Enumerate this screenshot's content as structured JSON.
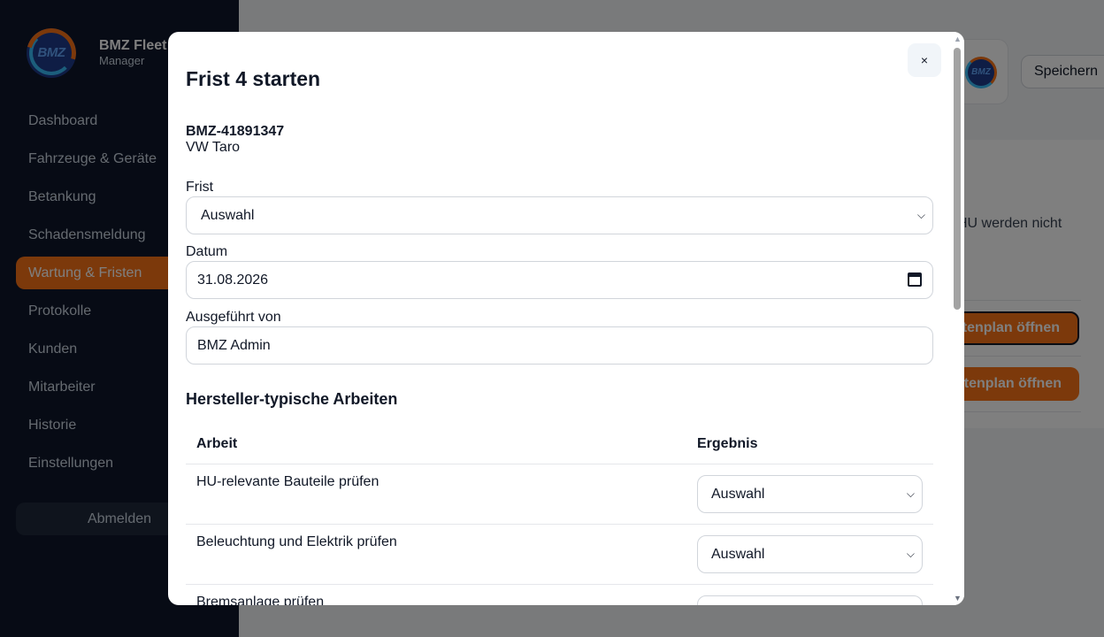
{
  "sidebar": {
    "brand_name": "BMZ Fleet",
    "brand_sub": "Manager",
    "logo_text": "BMZ",
    "items": [
      {
        "label": "Dashboard"
      },
      {
        "label": "Fahrzeuge & Geräte"
      },
      {
        "label": "Betankung"
      },
      {
        "label": "Schadensmeldung"
      },
      {
        "label": "Wartung & Fristen",
        "active": true
      },
      {
        "label": "Protokolle"
      },
      {
        "label": "Kunden"
      },
      {
        "label": "Mitarbeiter"
      },
      {
        "label": "Historie"
      },
      {
        "label": "Einstellungen"
      }
    ],
    "logout_label": "Abmelden"
  },
  "header": {
    "logo_text": "BMZ",
    "save_label": "Speichern"
  },
  "background_card": {
    "note": "HU werden nicht",
    "buttons": [
      "Fristenplan öffnen",
      "Fristenplan öffnen"
    ]
  },
  "modal": {
    "title": "Frist 4 starten",
    "close_label": "×",
    "vehicle_id": "BMZ-41891347",
    "vehicle_name": "VW Taro",
    "frist_label": "Frist",
    "frist_value": "Auswahl",
    "datum_label": "Datum",
    "datum_value": "31.08.2026",
    "executed_label": "Ausgeführt von",
    "executed_value": "BMZ Admin",
    "section_title": "Hersteller-typische Arbeiten",
    "table": {
      "col_work": "Arbeit",
      "col_result": "Ergebnis",
      "rows": [
        {
          "work": "HU-relevante Bauteile prüfen",
          "result": "Auswahl"
        },
        {
          "work": "Beleuchtung und Elektrik prüfen",
          "result": "Auswahl"
        },
        {
          "work": "Bremsanlage prüfen",
          "result": ""
        }
      ]
    }
  },
  "colors": {
    "sidebar_bg": "#0f172a",
    "accent": "#f97316",
    "overlay": "rgba(0,0,0,0.5)"
  }
}
